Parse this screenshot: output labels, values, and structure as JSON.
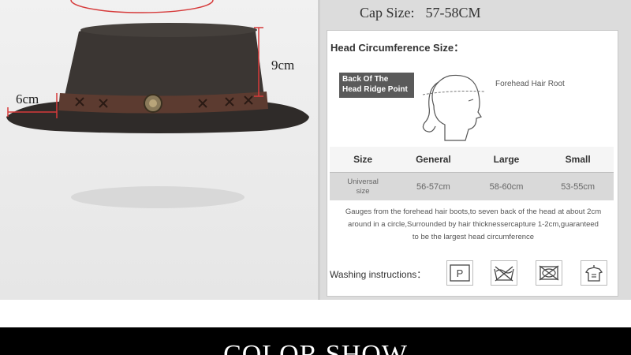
{
  "cap_size": {
    "label": "Cap Size:",
    "value": "57-58CM"
  },
  "dimensions": {
    "height": "9cm",
    "brim": "6cm"
  },
  "head_circumference": {
    "title": "Head Circumference Size：",
    "ridge_label_line1": "Back Of The",
    "ridge_label_line2": "Head Ridge Point",
    "forehead_label": "Forehead Hair Root"
  },
  "size_table": {
    "headers": [
      "Size",
      "General",
      "Large",
      "Small"
    ],
    "row": {
      "col1_line1": "Universal",
      "col1_line2": "size",
      "general": "56-57cm",
      "large": "58-60cm",
      "small": "53-55cm"
    }
  },
  "gauge_note": {
    "line1": "Gauges from the forehead hair boots,to seven back of the head at about 2cm",
    "line2": "around in a circle,Surrounded by hair thicknessercapture 1-2cm,guaranteed",
    "line3": "to be the largest head circumference"
  },
  "washing": {
    "label": "Washing instructions：",
    "icons": [
      "p-dry-clean-icon",
      "no-wash-icon",
      "no-tumble-dry-icon",
      "hang-dry-icon"
    ],
    "p_letter": "P"
  },
  "footer": {
    "title": "COLOR SHOW"
  },
  "colors": {
    "hat": "#3b3633",
    "band": "#5c3b30",
    "footer": "#000000"
  }
}
